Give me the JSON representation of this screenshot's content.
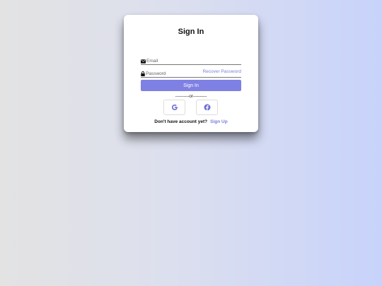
{
  "form": {
    "title": "Sign In",
    "email_placeholder": "Email",
    "email_value": "",
    "password_placeholder": "Password",
    "password_value": "",
    "recover_label": "Recover Password",
    "signin_label": "Sign In",
    "divider_text": "----------or----------",
    "social": [
      {
        "name": "google",
        "icon": "google-icon",
        "color": "#6b6fd4"
      },
      {
        "name": "facebook",
        "icon": "facebook-icon",
        "color": "#6b6fd4"
      }
    ],
    "no_account_text": "Don't have account yet?",
    "signup_label": "Sign Up"
  },
  "colors": {
    "accent": "#7f80e3",
    "link": "#7b7fd8",
    "card": "#ffffff"
  }
}
